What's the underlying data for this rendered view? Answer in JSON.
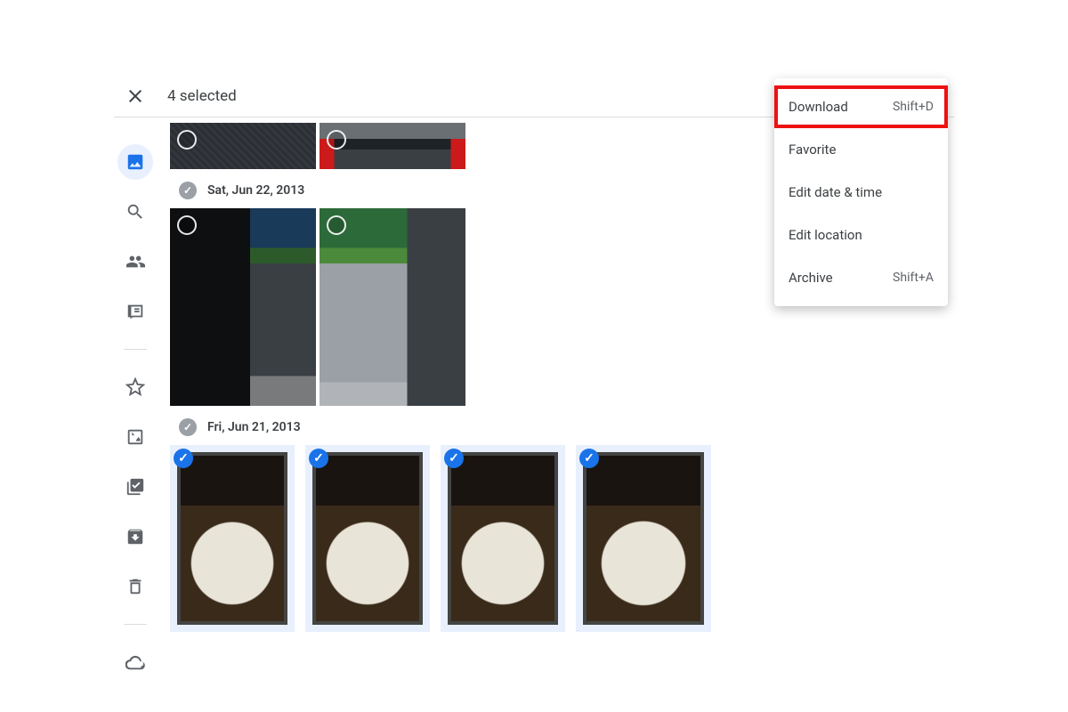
{
  "topbar": {
    "selection_text": "4 selected"
  },
  "dates": {
    "d1": "Sat, Jun 22, 2013",
    "d2": "Fri, Jun 21, 2013"
  },
  "menu": {
    "download": {
      "label": "Download",
      "shortcut": "Shift+D",
      "highlighted": true
    },
    "favorite": {
      "label": "Favorite"
    },
    "edit_date": {
      "label": "Edit date & time"
    },
    "edit_location": {
      "label": "Edit location"
    },
    "archive": {
      "label": "Archive",
      "shortcut": "Shift+A"
    }
  }
}
